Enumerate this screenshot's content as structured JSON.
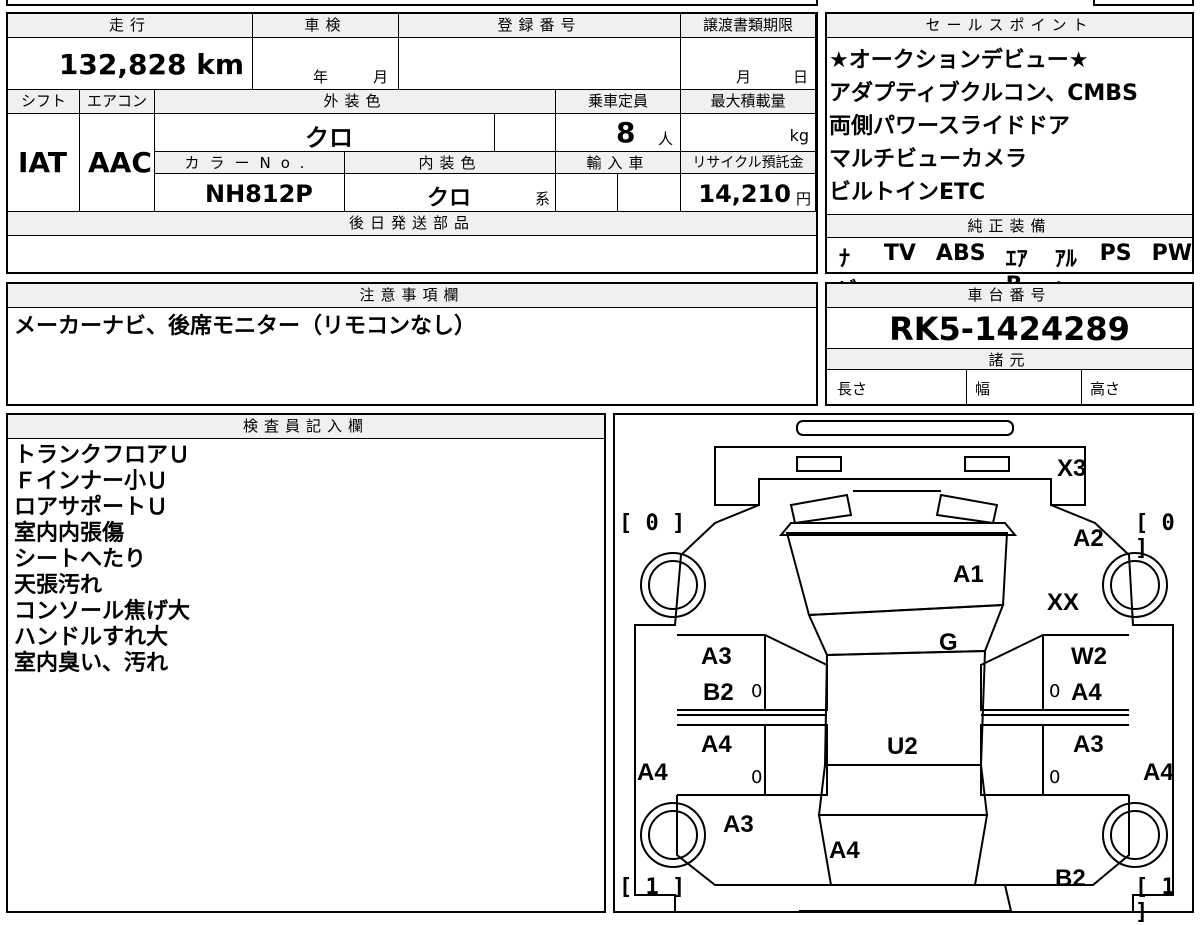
{
  "header": {
    "mileage_label": "走行",
    "shaken_label": "車検",
    "registration_label": "登録番号",
    "transfer_deadline_label": "譲渡書類期限",
    "mileage_value": "132,828 km",
    "shaken_year": "年",
    "shaken_month": "月",
    "deadline_month": "月",
    "deadline_day": "日",
    "shift_label": "シフト",
    "aircon_label": "エアコン",
    "exterior_color_label": "外装色",
    "capacity_label": "乗車定員",
    "max_load_label": "最大積載量",
    "shift_value": "IAT",
    "aircon_value": "AAC",
    "exterior_color_value": "クロ",
    "capacity_value": "8",
    "capacity_unit": "人",
    "load_unit": "kg",
    "color_no_label": "カラーNo.",
    "interior_color_label": "内装色",
    "import_label": "輸入車",
    "recycle_label": "リサイクル預託金",
    "color_no_value": "NH812P",
    "interior_color_value": "クロ",
    "interior_suffix": "系",
    "recycle_value": "14,210",
    "recycle_unit": "円",
    "later_parts_label": "後日発送部品"
  },
  "sales_points": {
    "label": "セールスポイント",
    "items": [
      "★オークションデビュー★",
      "アダプティブクルコン、CMBS",
      "両側パワースライドドア",
      "マルチビューカメラ",
      "ビルトインETC"
    ]
  },
  "equipment": {
    "label": "純正装備",
    "items": [
      "ﾅﾋﾞ",
      "TV",
      "ABS",
      "ｴｱB",
      "ｱﾙﾐ",
      "PS",
      "PW"
    ]
  },
  "notes": {
    "label": "注意事項欄",
    "text": "メーカーナビ、後席モニター（リモコンなし）"
  },
  "chassis": {
    "label": "車台番号",
    "value": "RK5-1424289",
    "specs_label": "諸元",
    "length_label": "長さ",
    "width_label": "幅",
    "height_label": "高さ"
  },
  "inspector": {
    "label": "検査員記入欄",
    "lines": [
      "トランクフロアＵ",
      "Ｆインナー小Ｕ",
      "ロアサポートＵ",
      "室内内張傷",
      "シートへたり",
      "天張汚れ",
      "コンソール焦げ大",
      "ハンドルすれ大",
      "室内臭い、汚れ"
    ]
  },
  "diagram": {
    "marks": {
      "rear": "X3",
      "a1": "A1",
      "a2": "A2",
      "xx": "XX",
      "g": "G",
      "l_front_door": "A3",
      "l_front_door2": "B2",
      "r_front_door": "W2",
      "r_front_door2": "A4",
      "l_rear_door": "A4",
      "r_rear_door": "A3",
      "roof": "U2",
      "l_side": "A4",
      "r_side": "A4",
      "l_rear_fender": "A3",
      "hood": "A4",
      "r_rear_fender": "B2",
      "zero1": "0",
      "zero2": "0",
      "zero3": "0",
      "zero4": "0"
    },
    "tires": {
      "lr": "[ 0 ]",
      "rr": "[ 0 ]",
      "lf": "[ 1 ]",
      "rf": "[ 1 ]"
    }
  }
}
